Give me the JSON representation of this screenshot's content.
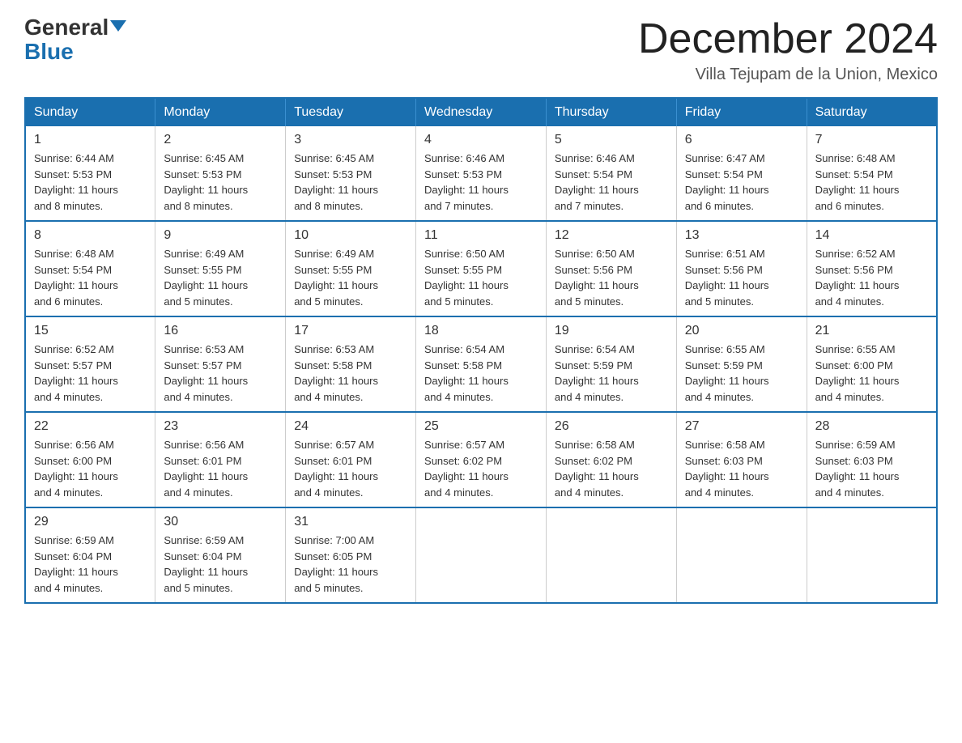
{
  "header": {
    "logo_line1": "General",
    "logo_line2": "Blue",
    "month_title": "December 2024",
    "location": "Villa Tejupam de la Union, Mexico"
  },
  "days_of_week": [
    "Sunday",
    "Monday",
    "Tuesday",
    "Wednesday",
    "Thursday",
    "Friday",
    "Saturday"
  ],
  "weeks": [
    [
      {
        "day": "1",
        "sunrise": "6:44 AM",
        "sunset": "5:53 PM",
        "daylight": "11 hours and 8 minutes."
      },
      {
        "day": "2",
        "sunrise": "6:45 AM",
        "sunset": "5:53 PM",
        "daylight": "11 hours and 8 minutes."
      },
      {
        "day": "3",
        "sunrise": "6:45 AM",
        "sunset": "5:53 PM",
        "daylight": "11 hours and 8 minutes."
      },
      {
        "day": "4",
        "sunrise": "6:46 AM",
        "sunset": "5:53 PM",
        "daylight": "11 hours and 7 minutes."
      },
      {
        "day": "5",
        "sunrise": "6:46 AM",
        "sunset": "5:54 PM",
        "daylight": "11 hours and 7 minutes."
      },
      {
        "day": "6",
        "sunrise": "6:47 AM",
        "sunset": "5:54 PM",
        "daylight": "11 hours and 6 minutes."
      },
      {
        "day": "7",
        "sunrise": "6:48 AM",
        "sunset": "5:54 PM",
        "daylight": "11 hours and 6 minutes."
      }
    ],
    [
      {
        "day": "8",
        "sunrise": "6:48 AM",
        "sunset": "5:54 PM",
        "daylight": "11 hours and 6 minutes."
      },
      {
        "day": "9",
        "sunrise": "6:49 AM",
        "sunset": "5:55 PM",
        "daylight": "11 hours and 5 minutes."
      },
      {
        "day": "10",
        "sunrise": "6:49 AM",
        "sunset": "5:55 PM",
        "daylight": "11 hours and 5 minutes."
      },
      {
        "day": "11",
        "sunrise": "6:50 AM",
        "sunset": "5:55 PM",
        "daylight": "11 hours and 5 minutes."
      },
      {
        "day": "12",
        "sunrise": "6:50 AM",
        "sunset": "5:56 PM",
        "daylight": "11 hours and 5 minutes."
      },
      {
        "day": "13",
        "sunrise": "6:51 AM",
        "sunset": "5:56 PM",
        "daylight": "11 hours and 5 minutes."
      },
      {
        "day": "14",
        "sunrise": "6:52 AM",
        "sunset": "5:56 PM",
        "daylight": "11 hours and 4 minutes."
      }
    ],
    [
      {
        "day": "15",
        "sunrise": "6:52 AM",
        "sunset": "5:57 PM",
        "daylight": "11 hours and 4 minutes."
      },
      {
        "day": "16",
        "sunrise": "6:53 AM",
        "sunset": "5:57 PM",
        "daylight": "11 hours and 4 minutes."
      },
      {
        "day": "17",
        "sunrise": "6:53 AM",
        "sunset": "5:58 PM",
        "daylight": "11 hours and 4 minutes."
      },
      {
        "day": "18",
        "sunrise": "6:54 AM",
        "sunset": "5:58 PM",
        "daylight": "11 hours and 4 minutes."
      },
      {
        "day": "19",
        "sunrise": "6:54 AM",
        "sunset": "5:59 PM",
        "daylight": "11 hours and 4 minutes."
      },
      {
        "day": "20",
        "sunrise": "6:55 AM",
        "sunset": "5:59 PM",
        "daylight": "11 hours and 4 minutes."
      },
      {
        "day": "21",
        "sunrise": "6:55 AM",
        "sunset": "6:00 PM",
        "daylight": "11 hours and 4 minutes."
      }
    ],
    [
      {
        "day": "22",
        "sunrise": "6:56 AM",
        "sunset": "6:00 PM",
        "daylight": "11 hours and 4 minutes."
      },
      {
        "day": "23",
        "sunrise": "6:56 AM",
        "sunset": "6:01 PM",
        "daylight": "11 hours and 4 minutes."
      },
      {
        "day": "24",
        "sunrise": "6:57 AM",
        "sunset": "6:01 PM",
        "daylight": "11 hours and 4 minutes."
      },
      {
        "day": "25",
        "sunrise": "6:57 AM",
        "sunset": "6:02 PM",
        "daylight": "11 hours and 4 minutes."
      },
      {
        "day": "26",
        "sunrise": "6:58 AM",
        "sunset": "6:02 PM",
        "daylight": "11 hours and 4 minutes."
      },
      {
        "day": "27",
        "sunrise": "6:58 AM",
        "sunset": "6:03 PM",
        "daylight": "11 hours and 4 minutes."
      },
      {
        "day": "28",
        "sunrise": "6:59 AM",
        "sunset": "6:03 PM",
        "daylight": "11 hours and 4 minutes."
      }
    ],
    [
      {
        "day": "29",
        "sunrise": "6:59 AM",
        "sunset": "6:04 PM",
        "daylight": "11 hours and 4 minutes."
      },
      {
        "day": "30",
        "sunrise": "6:59 AM",
        "sunset": "6:04 PM",
        "daylight": "11 hours and 5 minutes."
      },
      {
        "day": "31",
        "sunrise": "7:00 AM",
        "sunset": "6:05 PM",
        "daylight": "11 hours and 5 minutes."
      },
      null,
      null,
      null,
      null
    ]
  ],
  "labels": {
    "sunrise": "Sunrise:",
    "sunset": "Sunset:",
    "daylight": "Daylight:"
  }
}
